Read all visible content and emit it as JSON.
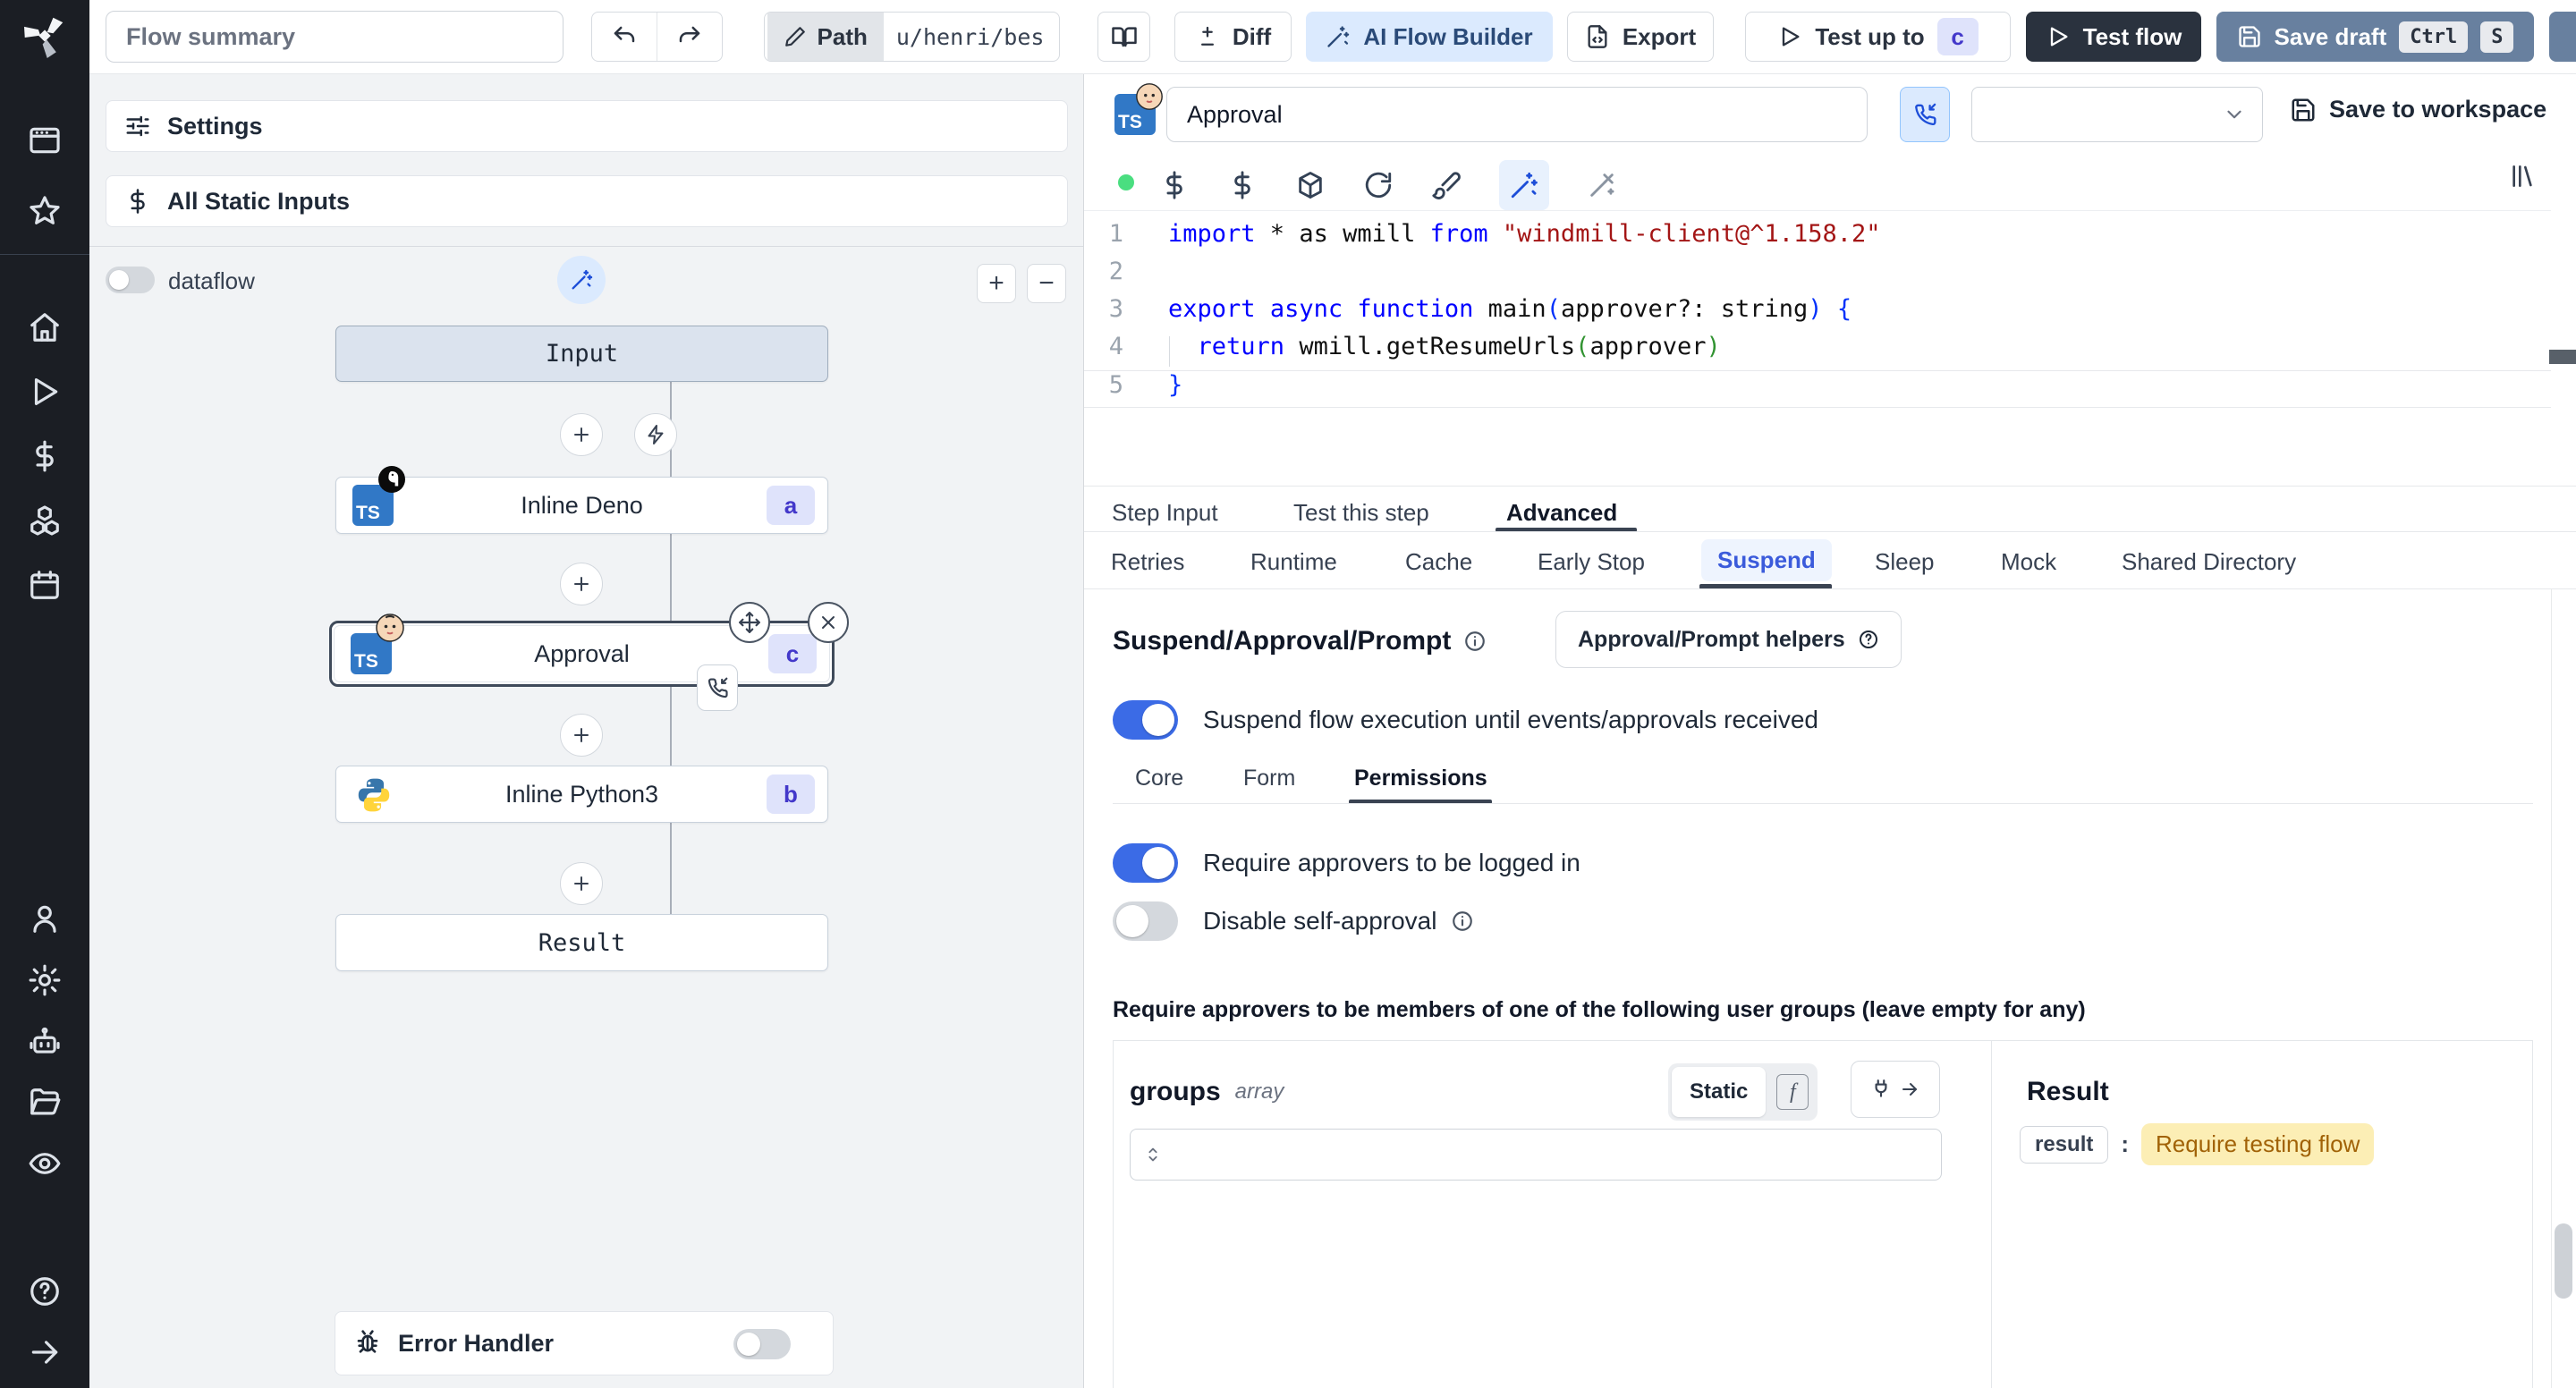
{
  "topbar": {
    "flow_summary_placeholder": "Flow summary",
    "path_label": "Path",
    "path_value": "u/henri/bes",
    "diff_label": "Diff",
    "ai_flow_builder_label": "AI Flow Builder",
    "export_label": "Export",
    "test_up_to_label": "Test up to",
    "test_up_to_badge": "c",
    "test_flow_label": "Test flow",
    "save_draft_label": "Save draft",
    "kbd_ctrl": "Ctrl",
    "kbd_s": "S"
  },
  "flow_panel": {
    "settings_label": "Settings",
    "static_inputs_label": "All Static Inputs",
    "dataflow_label": "dataflow",
    "zoom_in_label": "+",
    "zoom_out_label": "−",
    "input_node_label": "Input",
    "deno_node_label": "Inline Deno",
    "deno_badge": "a",
    "approval_node_label": "Approval",
    "approval_badge": "c",
    "python_node_label": "Inline Python3",
    "python_badge": "b",
    "result_node_label": "Result",
    "error_handler_label": "Error Handler",
    "ts_badge": "TS"
  },
  "step_header": {
    "name_value": "Approval",
    "save_to_workspace_label": "Save to workspace",
    "ts_badge": "TS"
  },
  "editor": {
    "l1": {
      "n": "1",
      "k1": "import",
      "p1": " * as wmill ",
      "k2": "from",
      "s1": " \"windmill-client@^1.158.2\""
    },
    "l2": {
      "n": "2"
    },
    "l3": {
      "n": "3",
      "k1": "export",
      "sp1": " ",
      "k2": "async",
      "sp2": " ",
      "k3": "function",
      "p1": " main",
      "b1": "(",
      "p2": "approver?: string",
      "b2": ")",
      "p3": " ",
      "b3": "{"
    },
    "l4": {
      "n": "4",
      "p1": "  ",
      "k1": "return",
      "p2": " wmill.getResumeUrls",
      "g1": "(",
      "p3": "approver",
      "g2": ")"
    },
    "l5": {
      "n": "5",
      "b1": "}"
    }
  },
  "step_tabs": {
    "step_input": "Step Input",
    "test_this_step": "Test this step",
    "advanced": "Advanced"
  },
  "advanced_tabs": {
    "retries": "Retries",
    "runtime": "Runtime",
    "cache": "Cache",
    "early_stop": "Early Stop",
    "suspend": "Suspend",
    "sleep": "Sleep",
    "mock": "Mock",
    "shared_directory": "Shared Directory"
  },
  "suspend_section": {
    "title": "Suspend/Approval/Prompt",
    "helpers_label": "Approval/Prompt helpers",
    "suspend_toggle_label": "Suspend flow execution until events/approvals received",
    "core_tab": "Core",
    "form_tab": "Form",
    "permissions_tab": "Permissions",
    "require_login_label": "Require approvers to be logged in",
    "disable_self_label": "Disable self-approval",
    "groups_heading": "Require approvers to be members of one of the following user groups (leave empty for any)",
    "groups_name": "groups",
    "groups_type": "array",
    "static_label": "Static",
    "fx_label": "f",
    "result_title": "Result",
    "result_key": "result",
    "colon": ":",
    "result_value": "Require testing flow"
  },
  "colors": {
    "accent_blue": "#3b6be6",
    "light_blue_bg": "#dbeafe",
    "badge_bg": "#dfe3fb",
    "badge_text": "#4338ca",
    "dark_button": "#2a323e",
    "save_draft_button": "#68809f",
    "code_keyword": "#0000ff",
    "code_string": "#a31515",
    "bracket_blue": "#0431fa",
    "bracket_green": "#319331",
    "result_highlight_bg": "#fceeb5",
    "result_highlight_text": "#a16207",
    "status_dot_green": "#4ade80"
  }
}
